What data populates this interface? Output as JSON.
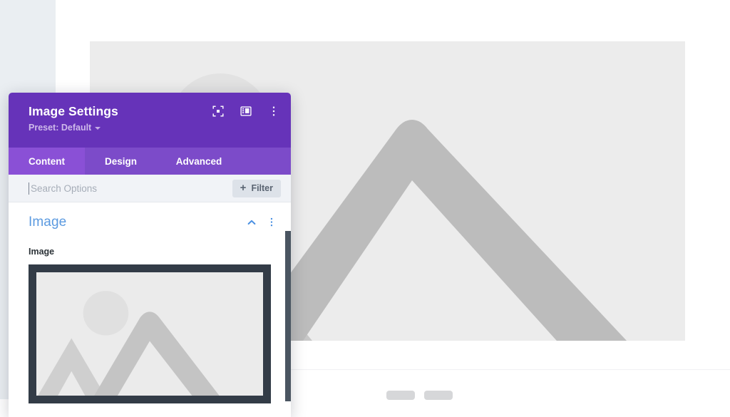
{
  "canvas": {
    "name": "page-canvas",
    "hero_image_alt": "image-placeholder",
    "ghost_buttons": [
      "",
      ""
    ]
  },
  "modal": {
    "title": "Image Settings",
    "preset_label": "Preset: Default",
    "header_icons": [
      {
        "name": "focus-icon",
        "title": "Focus"
      },
      {
        "name": "layout-icon",
        "title": "Layout"
      },
      {
        "name": "more-vertical-icon",
        "title": "More Options"
      }
    ],
    "tabs": [
      {
        "label": "Content",
        "active": true
      },
      {
        "label": "Design",
        "active": false
      },
      {
        "label": "Advanced",
        "active": false
      }
    ],
    "search": {
      "value": "",
      "placeholder": "Search Options"
    },
    "filter_button": {
      "label": "Filter",
      "plus": "+"
    },
    "sections": [
      {
        "title": "Image",
        "collapse_icon": "chevron-up-icon",
        "menu_icon": "more-vertical-icon",
        "fields": [
          {
            "label": "Image",
            "type": "image-upload",
            "preview_alt": "image-placeholder"
          }
        ]
      }
    ]
  },
  "colors": {
    "header_purple": "#6633b9",
    "tabbar_purple": "#7c4bc9",
    "tab_active_purple": "#8a50d6",
    "section_title_blue": "#5b9ae0",
    "filter_bg": "#dde2e9",
    "scrollbar": "#4a5561",
    "page_gutter": "#eaeef2",
    "hero_bg": "#ececec",
    "preview_border": "#333c47",
    "preview_bg": "#ebebeb"
  }
}
